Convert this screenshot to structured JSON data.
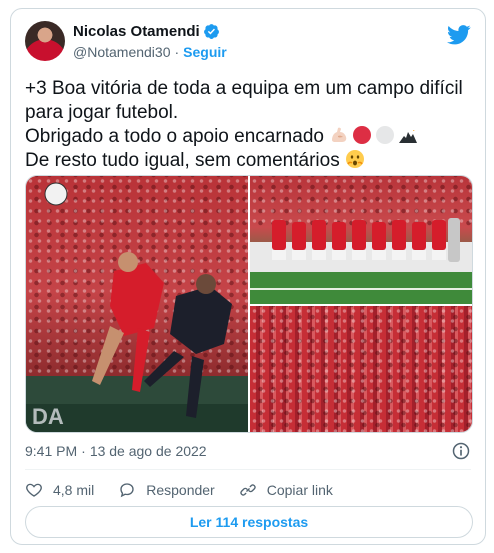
{
  "author": {
    "name": "Nicolas Otamendi",
    "handle": "@Notamendi30",
    "follow_label": "Seguir"
  },
  "tweet": {
    "lines": [
      "+3  Boa vitória de toda a equipa em um campo difícil",
      "para jogar futebol.",
      "Obrigado a todo o apoio encarnado",
      "De resto tudo igual, sem comentários"
    ],
    "emojis_line3": [
      "flexed-biceps-icon",
      "red-circle-icon",
      "white-circle-icon",
      "eagle-icon"
    ],
    "emoji_line4": "hushed-face-icon"
  },
  "media": {
    "count": 3
  },
  "meta": {
    "time": "9:41 PM",
    "separator": "·",
    "date": "13 de ago de 2022"
  },
  "actions": {
    "likes": "4,8 mil",
    "reply_label": "Responder",
    "copy_label": "Copiar link"
  },
  "replies_button": "Ler 114 respostas",
  "colors": {
    "accent": "#1d9bf0",
    "like_red": "#f91880",
    "text": "#0f1419",
    "secondary": "#536471"
  }
}
